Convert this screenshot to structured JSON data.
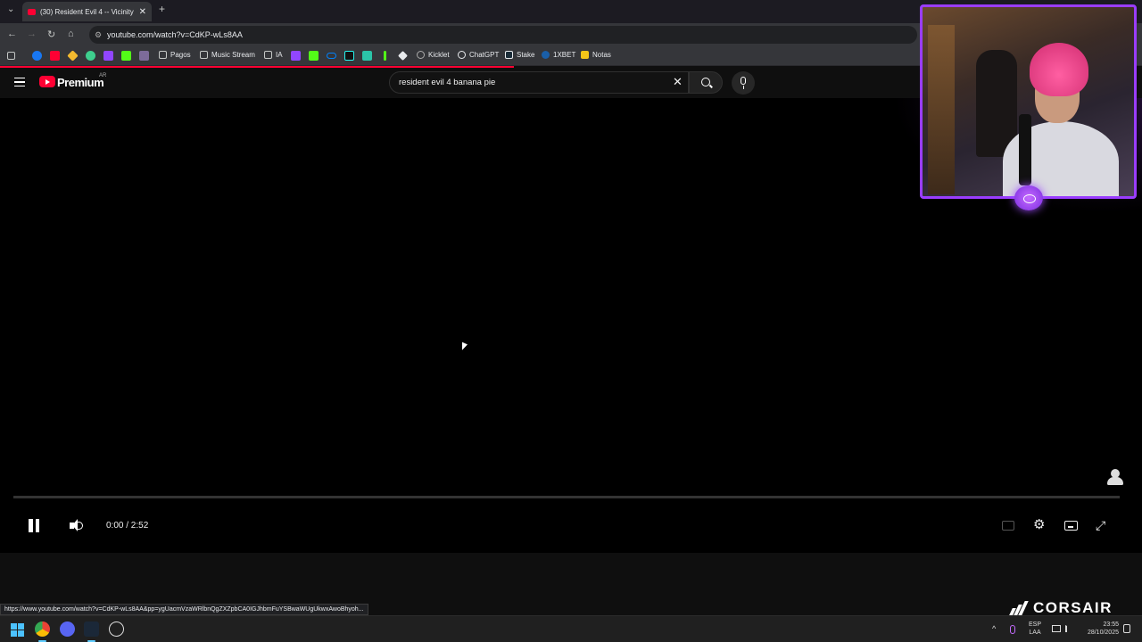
{
  "browser": {
    "tab_title": "(30) Resident Evil 4 -- Vicinity o",
    "tab_close": "✕",
    "new_tab": "+",
    "tab_list": "⌄",
    "url": "youtube.com/watch?v=CdKP-wLs8AA",
    "nav": {
      "back": "←",
      "forward": "→",
      "reload": "↻",
      "home": "⌂",
      "site_info": "⚙"
    },
    "bookmarks": [
      {
        "label": "Pagos",
        "type": "folder"
      },
      {
        "label": "Music Stream",
        "type": "folder"
      },
      {
        "label": "IA",
        "type": "folder"
      },
      {
        "label": "Kicklet",
        "type": "site"
      },
      {
        "label": "ChatGPT",
        "type": "site"
      },
      {
        "label": "Stake",
        "type": "site"
      },
      {
        "label": "1XBET",
        "type": "site"
      },
      {
        "label": "Notas",
        "type": "site"
      }
    ],
    "status_url": "https://www.youtube.com/watch?v=CdKP-wLs8AA&pp=ygUacmVzaWRlbnQgZXZpbCA0IGJhbmFuYSBwaWUgUkwxAwoBhyoh..."
  },
  "youtube": {
    "logo_text": "Premium",
    "region": "AR",
    "search_query": "resident evil 4 banana pie",
    "clear_icon": "✕"
  },
  "player": {
    "current_time": "0:00 / 2:52",
    "progress_fraction": 0,
    "settings_glyph": "⚙",
    "fullscreen_glyph": "⤢"
  },
  "overlay": {
    "brand": "CORSAIR"
  },
  "taskbar": {
    "lang_line1": "ESP",
    "lang_line2": "LAA",
    "time": "23:55",
    "date": "28/10/2025",
    "tray_up": "^"
  },
  "colors": {
    "yt_red": "#ff0033",
    "cam_border": "#9a3dff",
    "win_accent": "#4cc2ff"
  }
}
